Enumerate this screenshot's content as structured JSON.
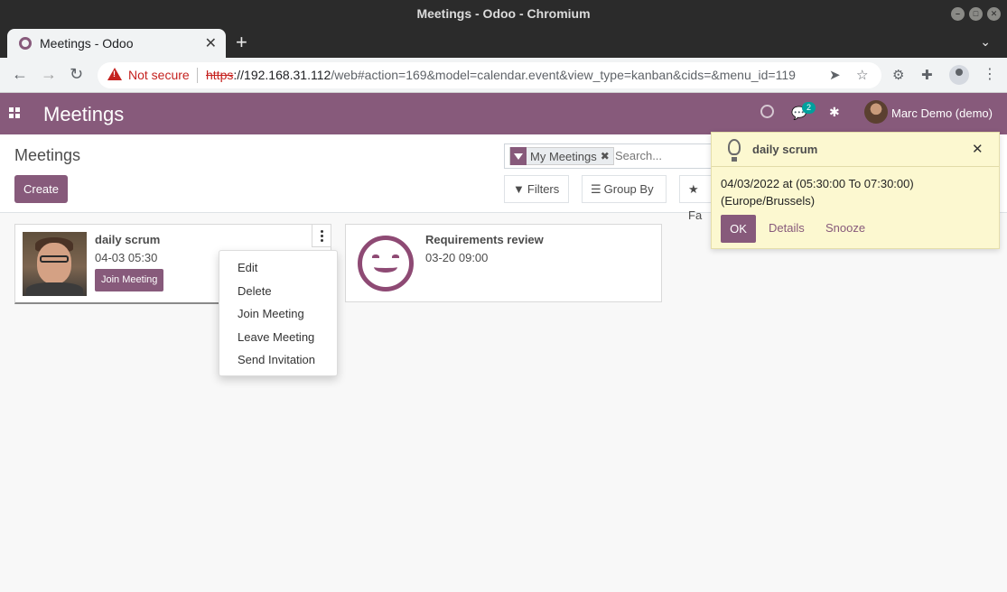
{
  "window": {
    "title": "Meetings - Odoo - Chromium"
  },
  "browser": {
    "tab_title": "Meetings - Odoo",
    "security_label": "Not secure",
    "url_scheme": "https",
    "url_host": "://192.168.31.112",
    "url_path": "/web#action=169&model=calendar.event&view_type=kanban&cids=&menu_id=119"
  },
  "navbar": {
    "app_name": "Meetings",
    "message_count": "2",
    "user_name": "Marc Demo (demo)"
  },
  "control_panel": {
    "breadcrumb": "Meetings",
    "create_label": "Create",
    "facet_label": "My Meetings",
    "search_placeholder": "Search...",
    "filters_label": "Filters",
    "group_by_label": "Group By",
    "favorites_label": "Fa"
  },
  "kanban": {
    "cards": [
      {
        "title": "daily scrum",
        "date": "04-03 05:30",
        "join_label": "Join Meeting"
      },
      {
        "title": "Requirements review",
        "date": "03-20 09:00"
      }
    ]
  },
  "dropdown": {
    "items": [
      "Edit",
      "Delete",
      "Join Meeting",
      "Leave Meeting",
      "Send Invitation"
    ]
  },
  "notification": {
    "title": "daily scrum",
    "body_line1": "04/03/2022 at (05:30:00 To 07:30:00)",
    "body_line2": "(Europe/Brussels)",
    "ok_label": "OK",
    "details_label": "Details",
    "snooze_label": "Snooze"
  },
  "colors": {
    "brand": "#875a7b",
    "notification_bg": "#fcf8d0",
    "badge": "#00a09d",
    "danger": "#c5221f"
  }
}
